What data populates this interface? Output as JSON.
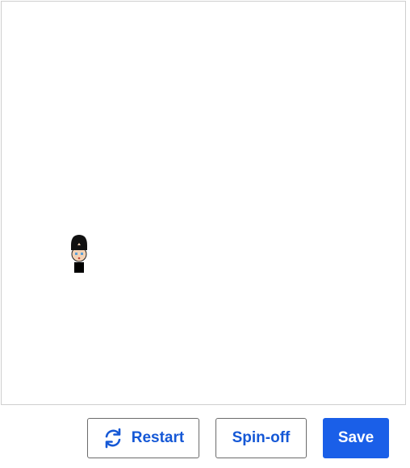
{
  "stage": {
    "sprite": {
      "icon": "person-sprite-icon"
    }
  },
  "toolbar": {
    "restart_label": "Restart",
    "restart_icon": "refresh-icon",
    "spinoff_label": "Spin-off",
    "save_label": "Save",
    "colors": {
      "primary": "#1a5fe8",
      "outline_text": "#1558d6",
      "outline_border": "#6b6b6b"
    }
  }
}
